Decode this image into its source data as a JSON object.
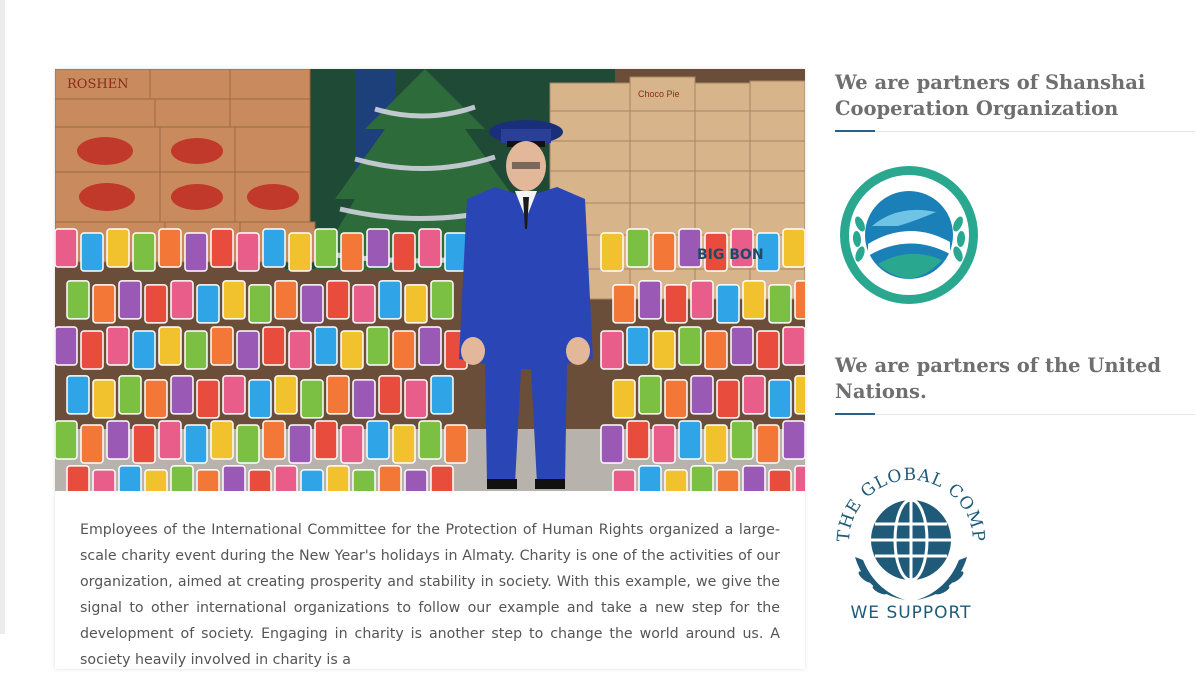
{
  "article": {
    "photo_signs": [
      "ROSHEN",
      "Choco Pie",
      "BIG BON"
    ],
    "body": "Employees of the International Committee for the Protection of Human Rights organized a large-scale charity event during the New Year's holidays in Almaty. Charity is one of the activities of our organization, aimed at creating prosperity and stability in society. With this example, we give the signal to other international organizations to follow our example and take a new step for the development of society. Engaging in charity is another step to change the world around us. A society heavily involved in charity is a"
  },
  "sidebar": {
    "sco": {
      "title": "We are partners of Shanshai Cooperation Organization",
      "logo_icon": "sco-emblem-icon"
    },
    "un": {
      "title": "We are partners of the United Nations.",
      "logo_icon": "global-compact-icon",
      "logo_arc_text": "THE GLOBAL COMPACT",
      "logo_bottom_text": "WE SUPPORT"
    }
  },
  "colors": {
    "accent": "#2a5f8c",
    "heading": "#6f6f6f",
    "body_text": "#555555",
    "sco_teal": "#2aa88f",
    "compact_blue": "#1f5a78"
  }
}
